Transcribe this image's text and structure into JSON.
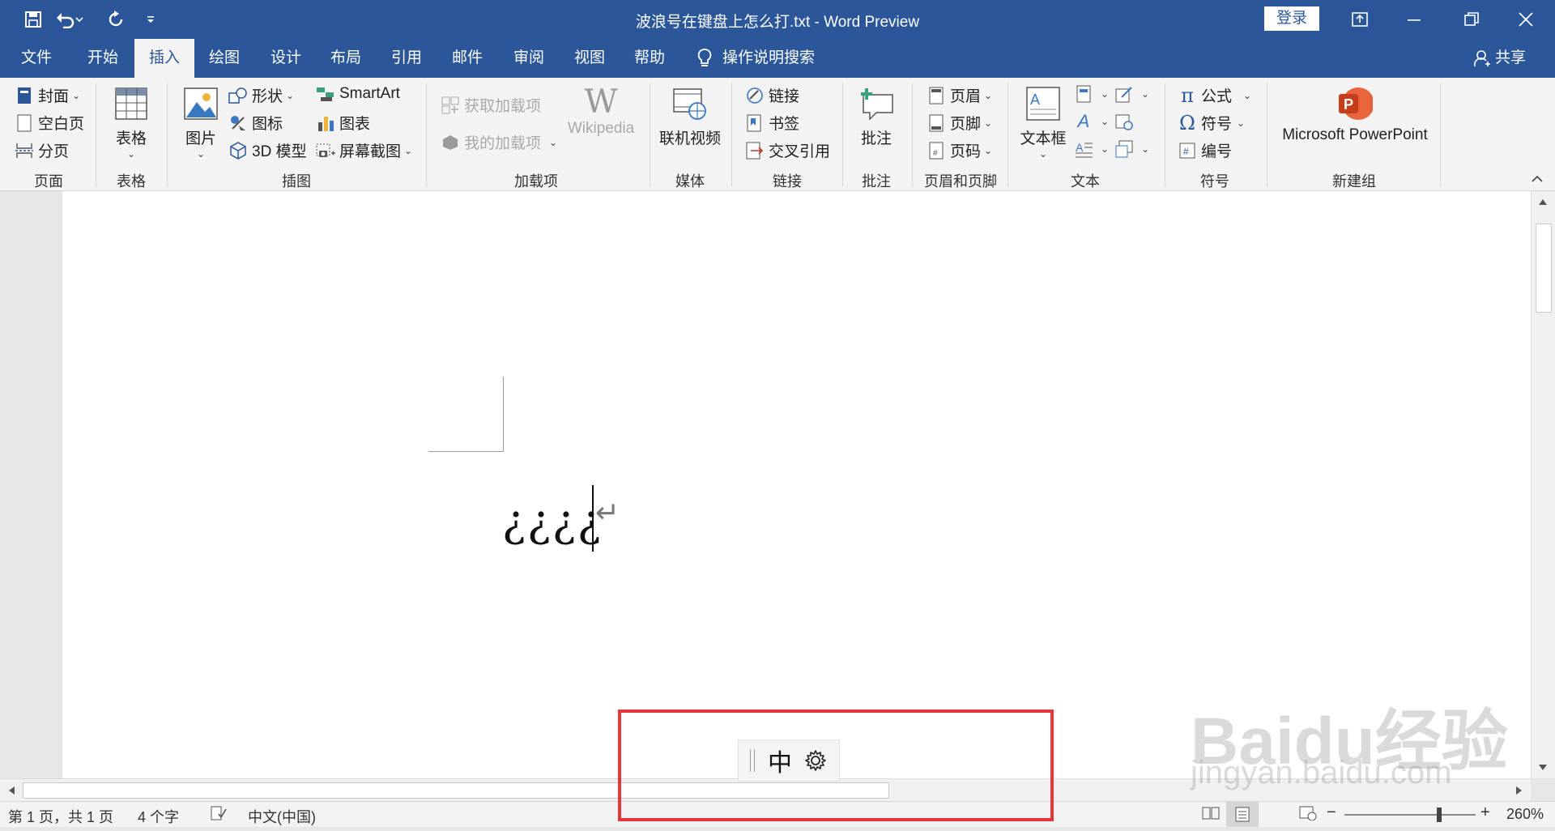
{
  "window": {
    "title": "波浪号在键盘上怎么打.txt - Word Preview",
    "login_label": "登录"
  },
  "tabs": [
    "文件",
    "开始",
    "插入",
    "绘图",
    "设计",
    "布局",
    "引用",
    "邮件",
    "审阅",
    "视图",
    "帮助"
  ],
  "active_tab": "插入",
  "tell_me": "操作说明搜索",
  "share_label": "共享",
  "ribbon": {
    "pages": {
      "label": "页面",
      "cover": "封面",
      "blank": "空白页",
      "break": "分页"
    },
    "tables": {
      "label": "表格",
      "table": "表格"
    },
    "illustrations": {
      "label": "插图",
      "pictures": "图片",
      "shapes": "形状",
      "icons": "图标",
      "model3d": "3D 模型",
      "smartart": "SmartArt",
      "chart": "图表",
      "screenshot": "屏幕截图"
    },
    "addins": {
      "label": "加载项",
      "get": "获取加载项",
      "mine": "我的加载项",
      "wikipedia": "Wikipedia"
    },
    "media": {
      "label": "媒体",
      "video": "联机视频"
    },
    "links": {
      "label": "链接",
      "link": "链接",
      "bookmark": "书签",
      "crossref": "交叉引用"
    },
    "comments": {
      "label": "批注",
      "comment": "批注"
    },
    "header_footer": {
      "label": "页眉和页脚",
      "header": "页眉",
      "footer": "页脚",
      "page_number": "页码"
    },
    "text": {
      "label": "文本",
      "textbox": "文本框"
    },
    "symbols": {
      "label": "符号",
      "equation": "公式",
      "symbol": "符号",
      "numbering": "编号"
    },
    "newgroup": {
      "label": "新建组",
      "powerpoint": "Microsoft PowerPoint"
    }
  },
  "document": {
    "text": "¿¿¿¿"
  },
  "status": {
    "page": "第 1 页，共 1 页",
    "words": "4 个字",
    "language": "中文(中国)",
    "zoom": "260%"
  },
  "ime": {
    "mode": "中"
  },
  "watermark": {
    "brand": "Baidu经验",
    "url": "jingyan.baidu.com"
  }
}
